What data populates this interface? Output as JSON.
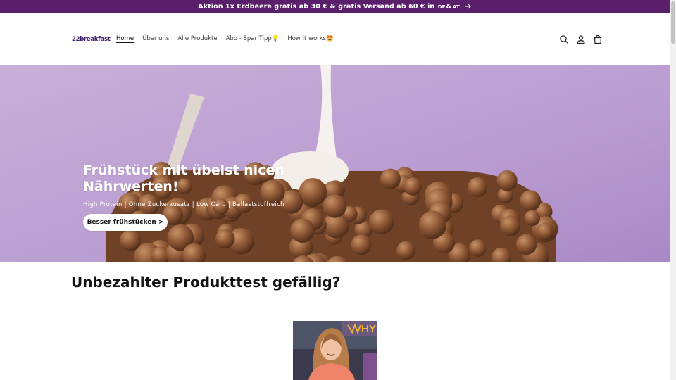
{
  "announcement": {
    "text": "Aktion 1x Erdbeere gratis ab 30 € & gratis Versand ab 60 € in",
    "country_de": "DE",
    "amp": "&",
    "country_at": "AT",
    "arrow_icon": "arrow-right-icon"
  },
  "header": {
    "logo": "22breakfast",
    "nav": [
      {
        "label": "Home"
      },
      {
        "label": "Über uns"
      },
      {
        "label": "Alle Produkte"
      },
      {
        "label": "Abo - Spar Tipp💡"
      },
      {
        "label": "How it works🤩"
      }
    ],
    "icons": [
      "search-icon",
      "account-icon",
      "cart-icon"
    ]
  },
  "hero": {
    "title": "Frühstück mit übelst nicen Nährwerten!",
    "subtitle": "High Protein | Ohne Zuckerzusatz | Low Carb | Ballaststoffreich",
    "button": "Besser frühstücken >"
  },
  "section": {
    "title": "Unbezahlter Produkttest gefällig?"
  },
  "colors": {
    "announcement_bg": "#5a1f6b",
    "hero_bg": "#bfa3d4",
    "logo": "#3d1f6b"
  }
}
